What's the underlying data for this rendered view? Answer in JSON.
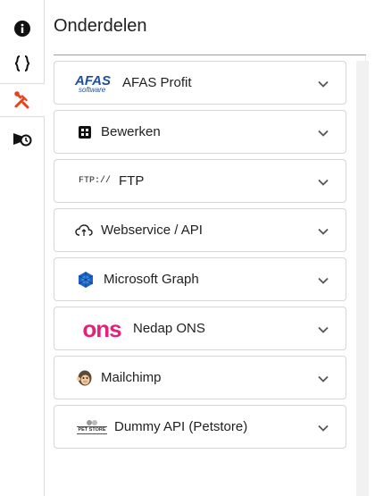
{
  "panel": {
    "title": "Onderdelen"
  },
  "rail": [
    {
      "name": "info-icon"
    },
    {
      "name": "code-braces-icon"
    },
    {
      "name": "tools-icon",
      "active": true
    },
    {
      "name": "scheduler-icon"
    }
  ],
  "items": [
    {
      "label": "AFAS Profit",
      "icon": "afas-logo-icon",
      "logo_text": "AFAS",
      "logo_sub": "software"
    },
    {
      "label": "Bewerken",
      "icon": "grid-box-icon"
    },
    {
      "label": "FTP",
      "icon": "ftp-icon",
      "logo_text": "FTP://"
    },
    {
      "label": "Webservice / API",
      "icon": "cloud-sync-icon"
    },
    {
      "label": "Microsoft Graph",
      "icon": "microsoft-graph-icon"
    },
    {
      "label": "Nedap ONS",
      "icon": "ons-logo-icon",
      "logo_text": "ons"
    },
    {
      "label": "Mailchimp",
      "icon": "mailchimp-icon"
    },
    {
      "label": "Dummy API (Petstore)",
      "icon": "petstore-logo-icon",
      "logo_text": "PET STORE"
    }
  ],
  "colors": {
    "accent": "#e8421b",
    "ons": "#e0247a",
    "afas": "#1f4fa0",
    "graph": "#1a63c6"
  }
}
